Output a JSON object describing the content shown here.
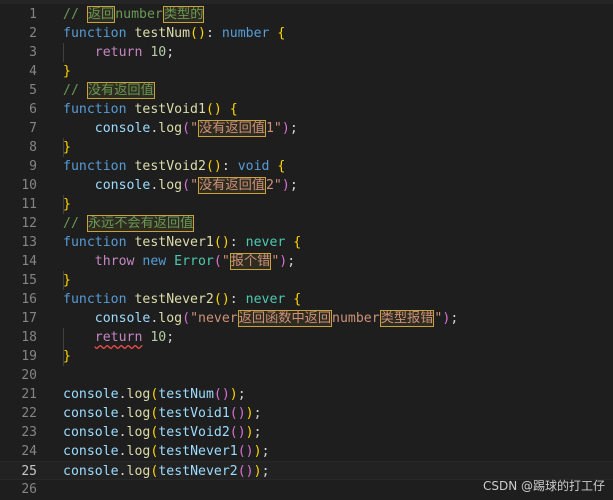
{
  "editor": {
    "active_line": 25,
    "lines": [
      {
        "n": 1,
        "tokens": [
          [
            "com",
            "// "
          ],
          [
            "com hl",
            "返回"
          ],
          [
            "com",
            "number"
          ],
          [
            "com hl",
            "类型的"
          ]
        ]
      },
      {
        "n": 2,
        "tokens": [
          [
            "kw",
            "function "
          ],
          [
            "fn",
            "testNum"
          ],
          [
            "b1",
            "()"
          ],
          [
            "punc",
            ": "
          ],
          [
            "kw",
            "number "
          ],
          [
            "b1",
            "{"
          ]
        ]
      },
      {
        "n": 3,
        "tokens": [
          [
            "punc",
            "    "
          ],
          [
            "ctrl",
            "return "
          ],
          [
            "num",
            "10"
          ],
          [
            "punc",
            ";"
          ]
        ]
      },
      {
        "n": 4,
        "tokens": [
          [
            "b1",
            "}"
          ]
        ]
      },
      {
        "n": 5,
        "tokens": [
          [
            "com",
            "// "
          ],
          [
            "com hl",
            "没有返回值"
          ]
        ]
      },
      {
        "n": 6,
        "tokens": [
          [
            "kw",
            "function "
          ],
          [
            "fn",
            "testVoid1"
          ],
          [
            "b1",
            "() {"
          ]
        ]
      },
      {
        "n": 7,
        "tokens": [
          [
            "punc",
            "    "
          ],
          [
            "var",
            "console"
          ],
          [
            "punc",
            "."
          ],
          [
            "fn",
            "log"
          ],
          [
            "b2",
            "("
          ],
          [
            "str",
            "\""
          ],
          [
            "str hl",
            "没有返回值"
          ],
          [
            "str",
            "1\""
          ],
          [
            "b2",
            ")"
          ],
          [
            "punc",
            ";"
          ]
        ]
      },
      {
        "n": 8,
        "tokens": [
          [
            "b1",
            "}"
          ]
        ]
      },
      {
        "n": 9,
        "tokens": [
          [
            "kw",
            "function "
          ],
          [
            "fn",
            "testVoid2"
          ],
          [
            "b1",
            "()"
          ],
          [
            "punc",
            ": "
          ],
          [
            "kw",
            "void "
          ],
          [
            "b1",
            "{"
          ]
        ]
      },
      {
        "n": 10,
        "tokens": [
          [
            "punc",
            "    "
          ],
          [
            "var",
            "console"
          ],
          [
            "punc",
            "."
          ],
          [
            "fn",
            "log"
          ],
          [
            "b2",
            "("
          ],
          [
            "str",
            "\""
          ],
          [
            "str hl",
            "没有返回值"
          ],
          [
            "str",
            "2\""
          ],
          [
            "b2",
            ")"
          ],
          [
            "punc",
            ";"
          ]
        ]
      },
      {
        "n": 11,
        "tokens": [
          [
            "b1",
            "}"
          ]
        ]
      },
      {
        "n": 12,
        "tokens": [
          [
            "com",
            "// "
          ],
          [
            "com hl",
            "永远不会有返回值"
          ]
        ]
      },
      {
        "n": 13,
        "tokens": [
          [
            "kw",
            "function "
          ],
          [
            "fn",
            "testNever1"
          ],
          [
            "b1",
            "()"
          ],
          [
            "punc",
            ": "
          ],
          [
            "type",
            "never "
          ],
          [
            "b1",
            "{"
          ]
        ]
      },
      {
        "n": 14,
        "tokens": [
          [
            "punc",
            "    "
          ],
          [
            "ctrl",
            "throw "
          ],
          [
            "kw",
            "new "
          ],
          [
            "type",
            "Error"
          ],
          [
            "b2",
            "("
          ],
          [
            "str",
            "\""
          ],
          [
            "str hl",
            "报个错"
          ],
          [
            "str",
            "\""
          ],
          [
            "b2",
            ")"
          ],
          [
            "punc",
            ";"
          ]
        ]
      },
      {
        "n": 15,
        "tokens": [
          [
            "b1",
            "}"
          ]
        ]
      },
      {
        "n": 16,
        "tokens": [
          [
            "kw",
            "function "
          ],
          [
            "fn",
            "testNever2"
          ],
          [
            "b1",
            "()"
          ],
          [
            "punc",
            ": "
          ],
          [
            "type",
            "never "
          ],
          [
            "b1",
            "{"
          ]
        ]
      },
      {
        "n": 17,
        "tokens": [
          [
            "punc",
            "    "
          ],
          [
            "var",
            "console"
          ],
          [
            "punc",
            "."
          ],
          [
            "fn",
            "log"
          ],
          [
            "b2",
            "("
          ],
          [
            "str",
            "\"never"
          ],
          [
            "str hl",
            "返回函数中返回"
          ],
          [
            "str",
            "number"
          ],
          [
            "str hl",
            "类型报错"
          ],
          [
            "str",
            "\""
          ],
          [
            "b2",
            ")"
          ],
          [
            "punc",
            ";"
          ]
        ]
      },
      {
        "n": 18,
        "tokens": [
          [
            "punc",
            "    "
          ],
          [
            "ctrl squig",
            "return"
          ],
          [
            "punc",
            " "
          ],
          [
            "num",
            "10"
          ],
          [
            "punc",
            ";"
          ]
        ]
      },
      {
        "n": 19,
        "tokens": [
          [
            "b1",
            "}"
          ]
        ]
      },
      {
        "n": 20,
        "tokens": []
      },
      {
        "n": 21,
        "tokens": [
          [
            "var",
            "console"
          ],
          [
            "punc",
            "."
          ],
          [
            "fn",
            "log"
          ],
          [
            "b1",
            "("
          ],
          [
            "var",
            "testNum"
          ],
          [
            "b2",
            "()"
          ],
          [
            "b1",
            ")"
          ],
          [
            "punc",
            ";"
          ]
        ]
      },
      {
        "n": 22,
        "tokens": [
          [
            "var",
            "console"
          ],
          [
            "punc",
            "."
          ],
          [
            "fn",
            "log"
          ],
          [
            "b1",
            "("
          ],
          [
            "var",
            "testVoid1"
          ],
          [
            "b2",
            "()"
          ],
          [
            "b1",
            ")"
          ],
          [
            "punc",
            ";"
          ]
        ]
      },
      {
        "n": 23,
        "tokens": [
          [
            "var",
            "console"
          ],
          [
            "punc",
            "."
          ],
          [
            "fn",
            "log"
          ],
          [
            "b1",
            "("
          ],
          [
            "var",
            "testVoid2"
          ],
          [
            "b2",
            "()"
          ],
          [
            "b1",
            ")"
          ],
          [
            "punc",
            ";"
          ]
        ]
      },
      {
        "n": 24,
        "tokens": [
          [
            "var",
            "console"
          ],
          [
            "punc",
            "."
          ],
          [
            "fn",
            "log"
          ],
          [
            "b1",
            "("
          ],
          [
            "var",
            "testNever1"
          ],
          [
            "b2",
            "()"
          ],
          [
            "b1",
            ")"
          ],
          [
            "punc",
            ";"
          ]
        ]
      },
      {
        "n": 25,
        "tokens": [
          [
            "var",
            "console"
          ],
          [
            "punc",
            "."
          ],
          [
            "fn",
            "log"
          ],
          [
            "b1",
            "("
          ],
          [
            "var",
            "testNever2"
          ],
          [
            "b2",
            "()"
          ],
          [
            "b1",
            ")"
          ],
          [
            "punc",
            ";"
          ]
        ]
      },
      {
        "n": 26,
        "tokens": []
      }
    ]
  },
  "watermark": "CSDN @踢球的打工仔",
  "colors": {
    "background": "#1e1e1e",
    "keyword": "#569cd6",
    "control": "#c586c0",
    "function": "#dcdcaa",
    "variable": "#9cdcfe",
    "type": "#4ec9b0",
    "number": "#b5cea8",
    "string": "#ce9178",
    "comment": "#6a9955",
    "bracket_level1": "#ffd700",
    "bracket_level2": "#da70d6",
    "highlight_border": "#c8a23a",
    "error_squiggle": "#f14c4c"
  }
}
